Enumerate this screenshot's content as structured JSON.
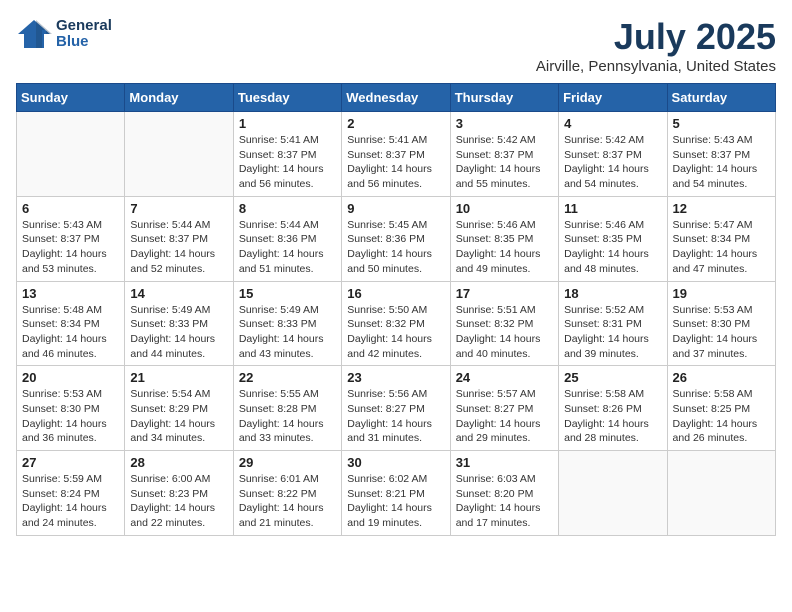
{
  "header": {
    "logo_line1": "General",
    "logo_line2": "Blue",
    "title": "July 2025",
    "location": "Airville, Pennsylvania, United States"
  },
  "weekdays": [
    "Sunday",
    "Monday",
    "Tuesday",
    "Wednesday",
    "Thursday",
    "Friday",
    "Saturday"
  ],
  "weeks": [
    [
      {
        "day": "",
        "info": ""
      },
      {
        "day": "",
        "info": ""
      },
      {
        "day": "1",
        "info": "Sunrise: 5:41 AM\nSunset: 8:37 PM\nDaylight: 14 hours\nand 56 minutes."
      },
      {
        "day": "2",
        "info": "Sunrise: 5:41 AM\nSunset: 8:37 PM\nDaylight: 14 hours\nand 56 minutes."
      },
      {
        "day": "3",
        "info": "Sunrise: 5:42 AM\nSunset: 8:37 PM\nDaylight: 14 hours\nand 55 minutes."
      },
      {
        "day": "4",
        "info": "Sunrise: 5:42 AM\nSunset: 8:37 PM\nDaylight: 14 hours\nand 54 minutes."
      },
      {
        "day": "5",
        "info": "Sunrise: 5:43 AM\nSunset: 8:37 PM\nDaylight: 14 hours\nand 54 minutes."
      }
    ],
    [
      {
        "day": "6",
        "info": "Sunrise: 5:43 AM\nSunset: 8:37 PM\nDaylight: 14 hours\nand 53 minutes."
      },
      {
        "day": "7",
        "info": "Sunrise: 5:44 AM\nSunset: 8:37 PM\nDaylight: 14 hours\nand 52 minutes."
      },
      {
        "day": "8",
        "info": "Sunrise: 5:44 AM\nSunset: 8:36 PM\nDaylight: 14 hours\nand 51 minutes."
      },
      {
        "day": "9",
        "info": "Sunrise: 5:45 AM\nSunset: 8:36 PM\nDaylight: 14 hours\nand 50 minutes."
      },
      {
        "day": "10",
        "info": "Sunrise: 5:46 AM\nSunset: 8:35 PM\nDaylight: 14 hours\nand 49 minutes."
      },
      {
        "day": "11",
        "info": "Sunrise: 5:46 AM\nSunset: 8:35 PM\nDaylight: 14 hours\nand 48 minutes."
      },
      {
        "day": "12",
        "info": "Sunrise: 5:47 AM\nSunset: 8:34 PM\nDaylight: 14 hours\nand 47 minutes."
      }
    ],
    [
      {
        "day": "13",
        "info": "Sunrise: 5:48 AM\nSunset: 8:34 PM\nDaylight: 14 hours\nand 46 minutes."
      },
      {
        "day": "14",
        "info": "Sunrise: 5:49 AM\nSunset: 8:33 PM\nDaylight: 14 hours\nand 44 minutes."
      },
      {
        "day": "15",
        "info": "Sunrise: 5:49 AM\nSunset: 8:33 PM\nDaylight: 14 hours\nand 43 minutes."
      },
      {
        "day": "16",
        "info": "Sunrise: 5:50 AM\nSunset: 8:32 PM\nDaylight: 14 hours\nand 42 minutes."
      },
      {
        "day": "17",
        "info": "Sunrise: 5:51 AM\nSunset: 8:32 PM\nDaylight: 14 hours\nand 40 minutes."
      },
      {
        "day": "18",
        "info": "Sunrise: 5:52 AM\nSunset: 8:31 PM\nDaylight: 14 hours\nand 39 minutes."
      },
      {
        "day": "19",
        "info": "Sunrise: 5:53 AM\nSunset: 8:30 PM\nDaylight: 14 hours\nand 37 minutes."
      }
    ],
    [
      {
        "day": "20",
        "info": "Sunrise: 5:53 AM\nSunset: 8:30 PM\nDaylight: 14 hours\nand 36 minutes."
      },
      {
        "day": "21",
        "info": "Sunrise: 5:54 AM\nSunset: 8:29 PM\nDaylight: 14 hours\nand 34 minutes."
      },
      {
        "day": "22",
        "info": "Sunrise: 5:55 AM\nSunset: 8:28 PM\nDaylight: 14 hours\nand 33 minutes."
      },
      {
        "day": "23",
        "info": "Sunrise: 5:56 AM\nSunset: 8:27 PM\nDaylight: 14 hours\nand 31 minutes."
      },
      {
        "day": "24",
        "info": "Sunrise: 5:57 AM\nSunset: 8:27 PM\nDaylight: 14 hours\nand 29 minutes."
      },
      {
        "day": "25",
        "info": "Sunrise: 5:58 AM\nSunset: 8:26 PM\nDaylight: 14 hours\nand 28 minutes."
      },
      {
        "day": "26",
        "info": "Sunrise: 5:58 AM\nSunset: 8:25 PM\nDaylight: 14 hours\nand 26 minutes."
      }
    ],
    [
      {
        "day": "27",
        "info": "Sunrise: 5:59 AM\nSunset: 8:24 PM\nDaylight: 14 hours\nand 24 minutes."
      },
      {
        "day": "28",
        "info": "Sunrise: 6:00 AM\nSunset: 8:23 PM\nDaylight: 14 hours\nand 22 minutes."
      },
      {
        "day": "29",
        "info": "Sunrise: 6:01 AM\nSunset: 8:22 PM\nDaylight: 14 hours\nand 21 minutes."
      },
      {
        "day": "30",
        "info": "Sunrise: 6:02 AM\nSunset: 8:21 PM\nDaylight: 14 hours\nand 19 minutes."
      },
      {
        "day": "31",
        "info": "Sunrise: 6:03 AM\nSunset: 8:20 PM\nDaylight: 14 hours\nand 17 minutes."
      },
      {
        "day": "",
        "info": ""
      },
      {
        "day": "",
        "info": ""
      }
    ]
  ]
}
